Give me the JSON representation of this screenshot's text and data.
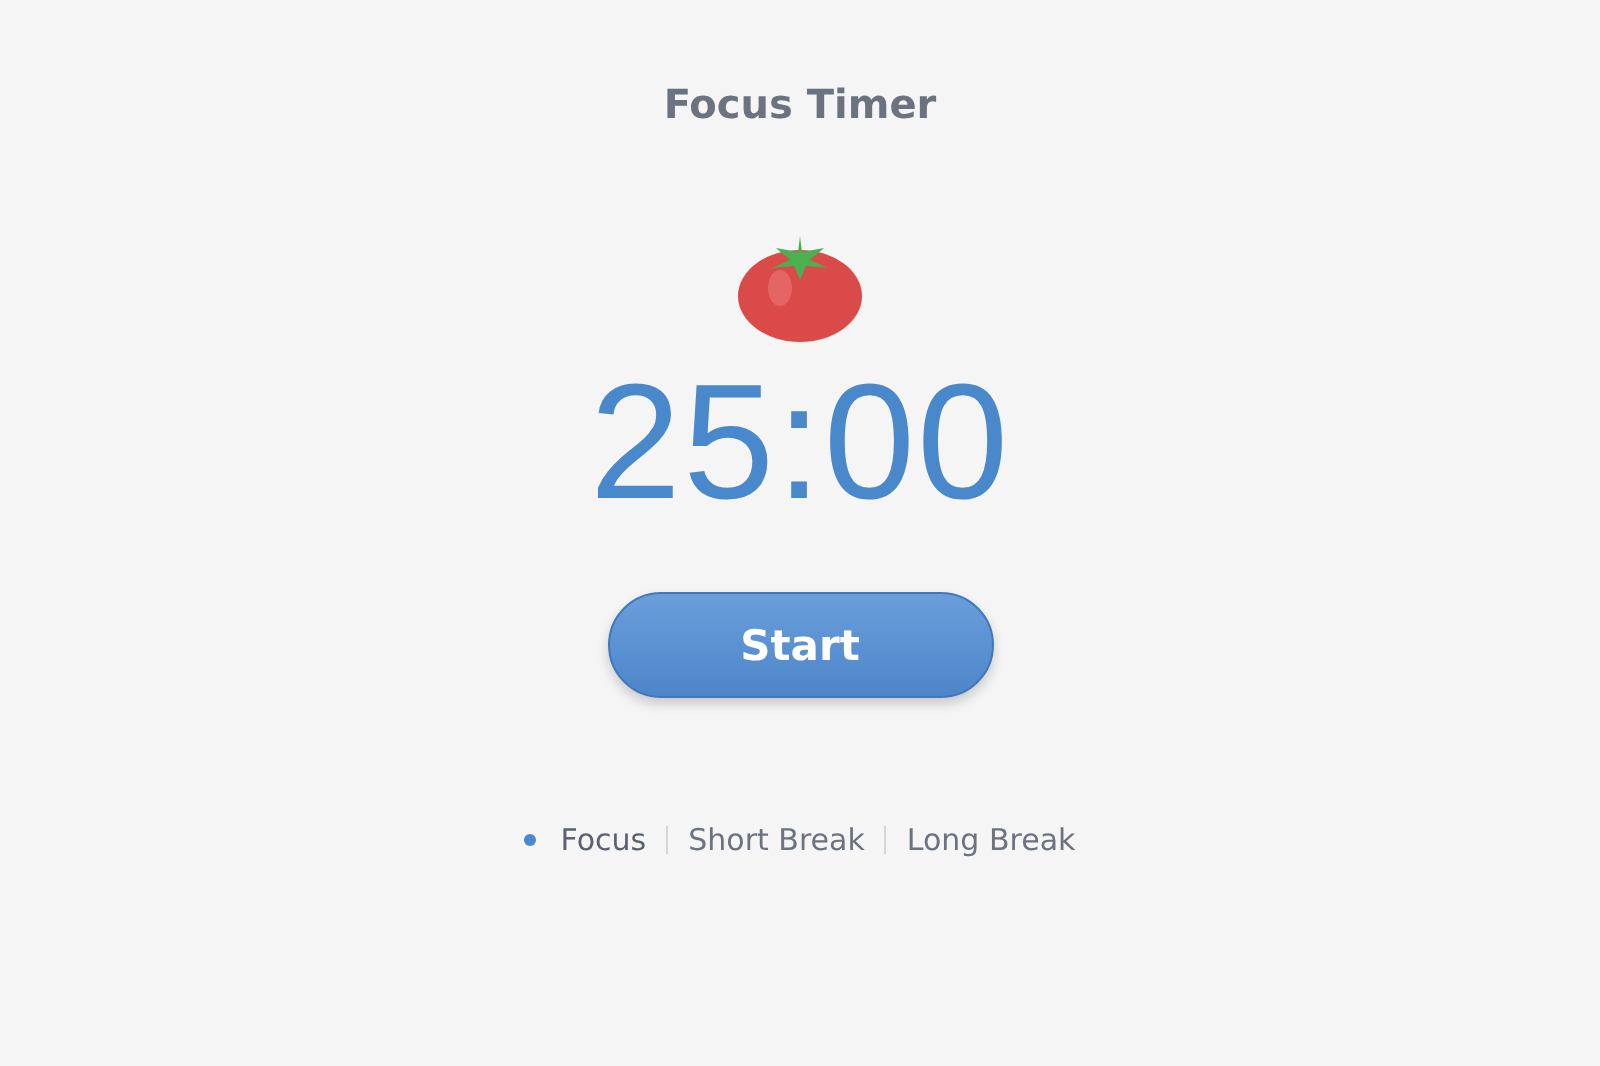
{
  "title": "Focus Timer",
  "time": "25:00",
  "button": {
    "label": "Start"
  },
  "modes": [
    {
      "label": "Focus",
      "selected": true
    },
    {
      "label": "Short Break",
      "selected": false
    },
    {
      "label": "Long Break",
      "selected": false
    }
  ]
}
